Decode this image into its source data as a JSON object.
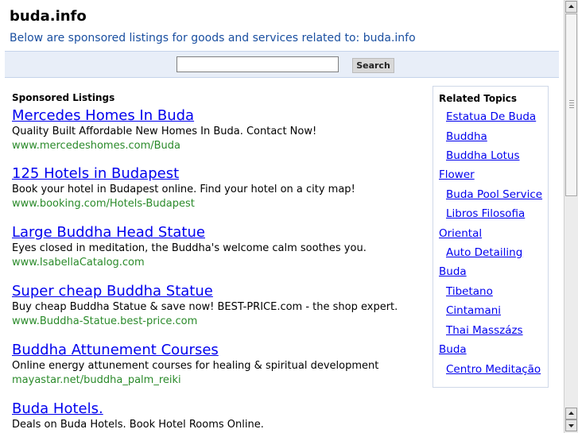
{
  "header": {
    "site_title": "buda.info",
    "subtitle": "Below are sponsored listings for goods and services related to: buda.info"
  },
  "search": {
    "value": "",
    "button_label": "Search"
  },
  "sponsored": {
    "heading": "Sponsored Listings",
    "listings": [
      {
        "title": "Mercedes Homes In Buda",
        "desc": "Quality Built Affordable New Homes In Buda. Contact Now!",
        "url": "www.mercedeshomes.com/Buda"
      },
      {
        "title": "125 Hotels in Budapest",
        "desc": "Book your hotel in Budapest online. Find your hotel on a city map!",
        "url": "www.booking.com/Hotels-Budapest"
      },
      {
        "title": "Large Buddha Head Statue",
        "desc": "Eyes closed in meditation, the Buddha's welcome calm soothes you.",
        "url": "www.IsabellaCatalog.com"
      },
      {
        "title": "Super cheap Buddha Statue",
        "desc": "Buy cheap Buddha Statue & save now! BEST-PRICE.com - the shop expert.",
        "url": "www.Buddha-Statue.best-price.com"
      },
      {
        "title": "Buddha Attunement Courses",
        "desc": "Online energy attunement courses for healing & spiritual development",
        "url": "mayastar.net/buddha_palm_reiki"
      },
      {
        "title": "Buda Hotels.",
        "desc": "Deals on Buda Hotels. Book Hotel Rooms Online.",
        "url": ""
      }
    ]
  },
  "related": {
    "heading": "Related Topics",
    "items": [
      "Estatua De Buda",
      "Buddha",
      "Buddha Lotus",
      "Flower",
      "Buda Pool Service",
      "Libros Filosofia",
      "Oriental",
      "Auto Detailing",
      "Buda",
      "Tibetano",
      "Cintamani",
      "Thai Masszázs",
      "Buda",
      "Centro Meditação"
    ]
  },
  "icons": {
    "scroll_up": "arrow-up-icon",
    "scroll_down": "arrow-down-icon"
  }
}
